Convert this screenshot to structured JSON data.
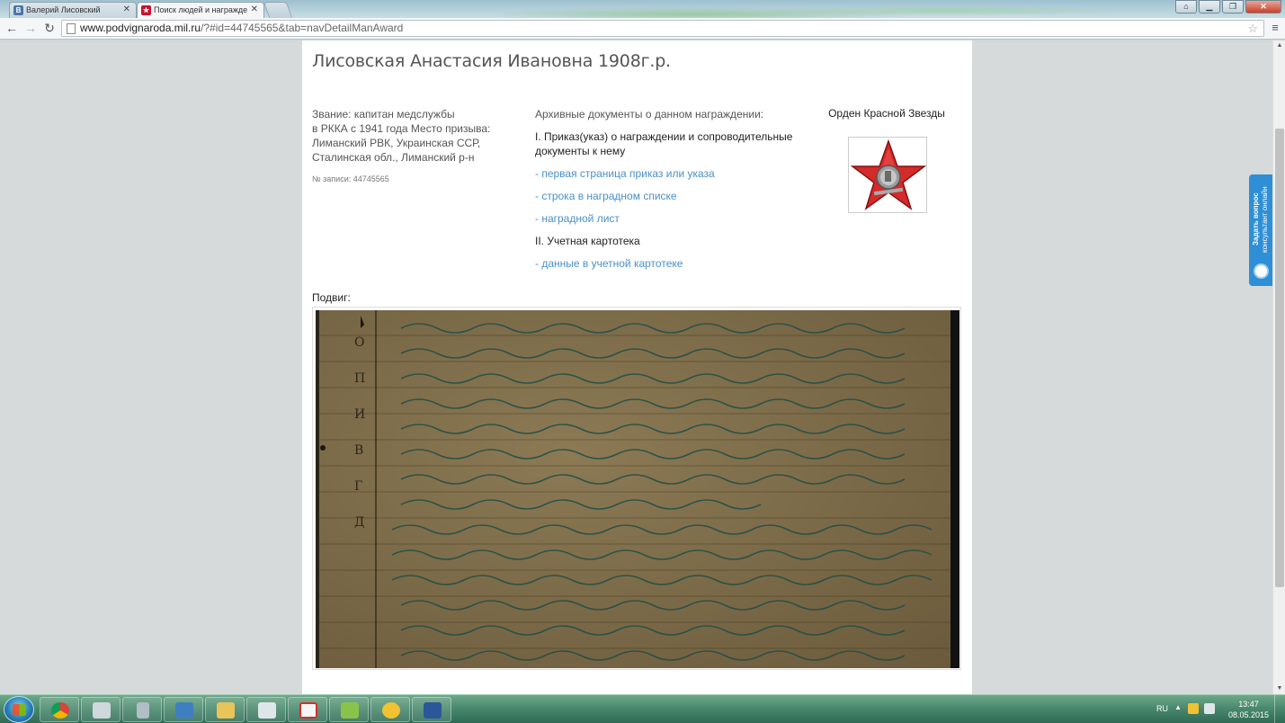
{
  "browser": {
    "tabs": [
      {
        "label": "Валерий Лисовский",
        "favicon": "vk-icon",
        "active": false
      },
      {
        "label": "Поиск людей и награжде",
        "favicon": "podvig-icon",
        "active": true
      }
    ],
    "url_host": "www.podvignaroda.mil.ru",
    "url_rest": "/?#id=44745565&tab=navDetailManAward"
  },
  "page": {
    "person_title": "Лисовская Анастасия Ивановна 1908г.р.",
    "info_lines": [
      "Звание: капитан медслужбы",
      "в РККА с 1941 года Место призыва:",
      "Лиманский РВК, Украинская ССР,",
      "Сталинская обл., Лиманский р-н"
    ],
    "record_number": "№ записи: 44745565",
    "docs_header": "Архивные документы о данном награждении:",
    "section1_title": "I. Приказ(указ) о награждении и сопроводительные документы к нему",
    "section1_links": [
      "- первая страница приказ или указа",
      "- строка в наградном списке",
      "- наградной лист"
    ],
    "section2_title": "II. Учетная картотека",
    "section2_links": [
      "- данные в учетной картотеке"
    ],
    "award_name": "Орден Красной Звезды",
    "feat_label": "Подвиг:",
    "scan_side_letters": [
      "О",
      "П",
      "И",
      "В",
      "Г",
      "Д"
    ]
  },
  "widget": {
    "consult_text_line1": "Задать вопрос",
    "consult_text_line2": "консультант онлайн"
  },
  "taskbar": {
    "lang": "RU",
    "time": "13:47",
    "date": "08.05.2015"
  },
  "colors": {
    "link": "#4a90c8",
    "award_star": "#d42a2a",
    "widget": "#2e8fd6"
  }
}
